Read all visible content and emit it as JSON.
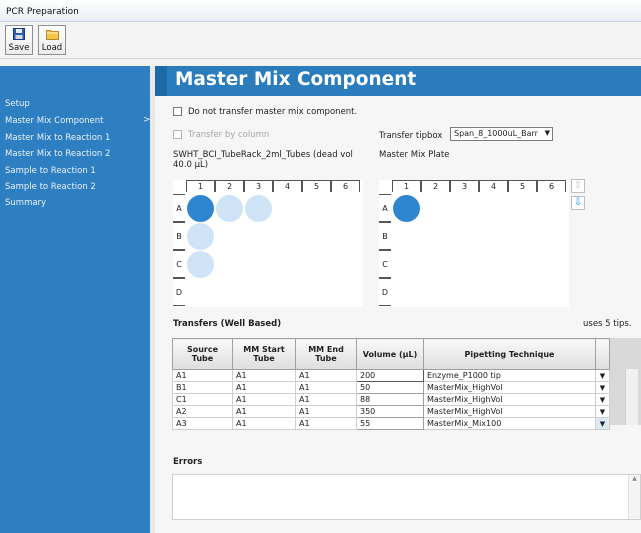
{
  "window": {
    "title": "PCR Preparation"
  },
  "toolbar": {
    "save_label": "Save",
    "load_label": "Load"
  },
  "sidebar": {
    "items": [
      {
        "label": "Setup"
      },
      {
        "label": "Master Mix Component"
      },
      {
        "label": "Master Mix to Reaction 1"
      },
      {
        "label": "Master Mix to Reaction 2"
      },
      {
        "label": "Sample to Reaction 1"
      },
      {
        "label": "Sample to Reaction 2"
      },
      {
        "label": "Summary"
      }
    ],
    "active_chevron": ">"
  },
  "main": {
    "title": "Master Mix Component",
    "no_transfer_label": "Do not transfer master mix component.",
    "transfer_by_column_label": "Transfer by column",
    "transfer_tipbox_label": "Transfer tipbox",
    "transfer_tipbox_value": "Span_8_1000uL_Barr",
    "source_rack_label": "SWHT_BCI_TubeRack_2ml_Tubes (dead vol 40.0 µL)",
    "plate_label": "Master Mix Plate",
    "source_rack": {
      "columns": [
        "1",
        "2",
        "3",
        "4",
        "5",
        "6"
      ],
      "rows": [
        "A",
        "B",
        "C",
        "D"
      ]
    },
    "plate": {
      "columns": [
        "1",
        "2",
        "3",
        "4",
        "5",
        "6"
      ],
      "rows": [
        "A",
        "B",
        "C",
        "D"
      ]
    },
    "transfers_label": "Transfers (Well Based)",
    "tips_label": "uses 5 tips.",
    "table": {
      "headers": [
        "Source Tube",
        "MM Start Tube",
        "MM End Tube",
        "Volume (µL)",
        "Pipetting Technique"
      ],
      "rows": [
        [
          "A1",
          "A1",
          "A1",
          "200",
          "Enzyme_P1000 tip"
        ],
        [
          "B1",
          "A1",
          "A1",
          "50",
          "MasterMix_HighVol"
        ],
        [
          "C1",
          "A1",
          "A1",
          "88",
          "MasterMix_HighVol"
        ],
        [
          "A2",
          "A1",
          "A1",
          "350",
          "MasterMix_HighVol"
        ],
        [
          "A3",
          "A1",
          "A1",
          "55",
          "MasterMix_Mix100"
        ]
      ]
    },
    "errors_label": "Errors"
  }
}
